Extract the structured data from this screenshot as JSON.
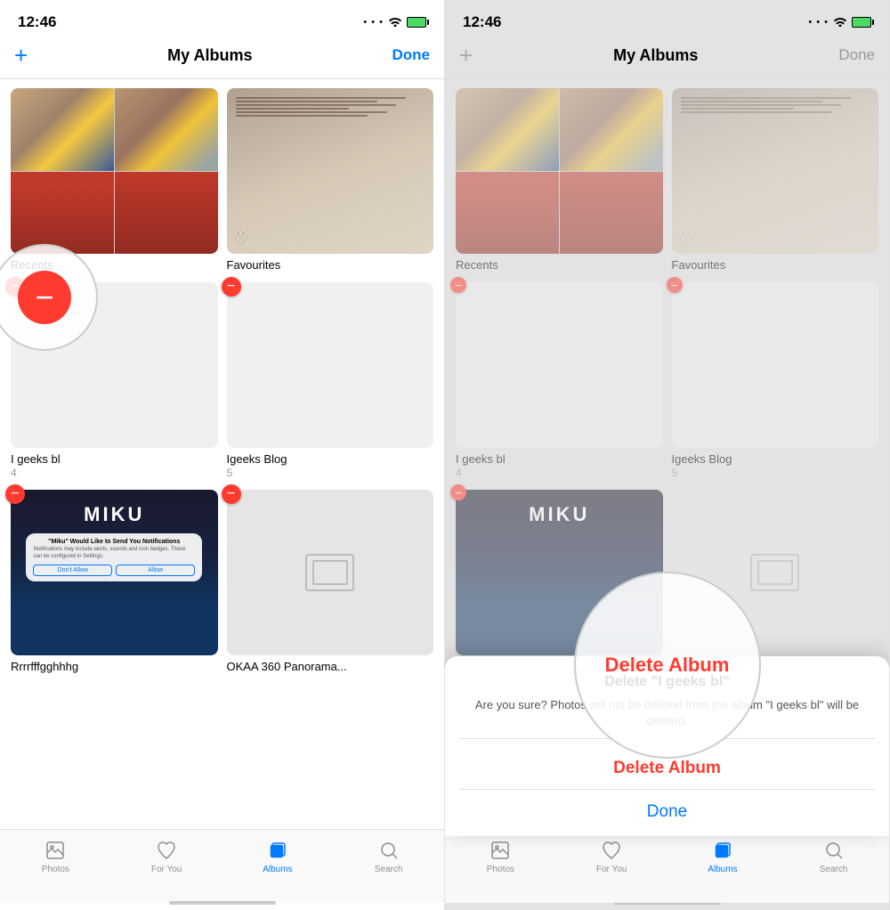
{
  "left_panel": {
    "status": {
      "time": "12:46",
      "signal": "...",
      "wifi": "wifi",
      "battery": "battery"
    },
    "nav": {
      "add_label": "+",
      "title": "My Albums",
      "done_label": "Done"
    },
    "albums": [
      {
        "id": "recents",
        "name": "Recents",
        "count": "",
        "type": "recents",
        "deletable": false
      },
      {
        "id": "favourites",
        "name": "Favourites",
        "count": "",
        "type": "favourites",
        "deletable": false
      },
      {
        "id": "igeeks-bl",
        "name": "I geeks bl",
        "count": "4",
        "type": "minion",
        "deletable": true
      },
      {
        "id": "igeeks-blog",
        "name": "Igeeks Blog",
        "count": "5",
        "type": "minion",
        "deletable": true
      },
      {
        "id": "rrrrfffgghhhg",
        "name": "Rrrrfffgghhhg",
        "count": "",
        "type": "miku",
        "deletable": true
      },
      {
        "id": "okaa360",
        "name": "OKAA 360 Panorama...",
        "count": "",
        "type": "panorama",
        "deletable": true
      }
    ],
    "big_delete_visible": true,
    "tabs": [
      {
        "id": "photos",
        "label": "Photos",
        "active": false,
        "icon": "photos-icon"
      },
      {
        "id": "for-you",
        "label": "For You",
        "active": false,
        "icon": "for-you-icon"
      },
      {
        "id": "albums",
        "label": "Albums",
        "active": true,
        "icon": "albums-icon"
      },
      {
        "id": "search",
        "label": "Search",
        "active": false,
        "icon": "search-icon"
      }
    ]
  },
  "right_panel": {
    "status": {
      "time": "12:46"
    },
    "nav": {
      "add_label": "+",
      "title": "My Albums",
      "done_label": "Done"
    },
    "delete_alert": {
      "title": "Delete \"I geeks bl\"",
      "body": "Are you sure you? otos will no album \"I geeks bl\"? ted.",
      "delete_btn": "Delete Album",
      "cancel_btn": "Done"
    },
    "tabs": [
      {
        "id": "photos",
        "label": "Photos",
        "active": false,
        "icon": "photos-icon"
      },
      {
        "id": "for-you",
        "label": "For You",
        "active": false,
        "icon": "for-you-icon"
      },
      {
        "id": "albums",
        "label": "Albums",
        "active": true,
        "icon": "albums-icon"
      },
      {
        "id": "search",
        "label": "Search",
        "active": false,
        "icon": "search-icon"
      }
    ]
  }
}
